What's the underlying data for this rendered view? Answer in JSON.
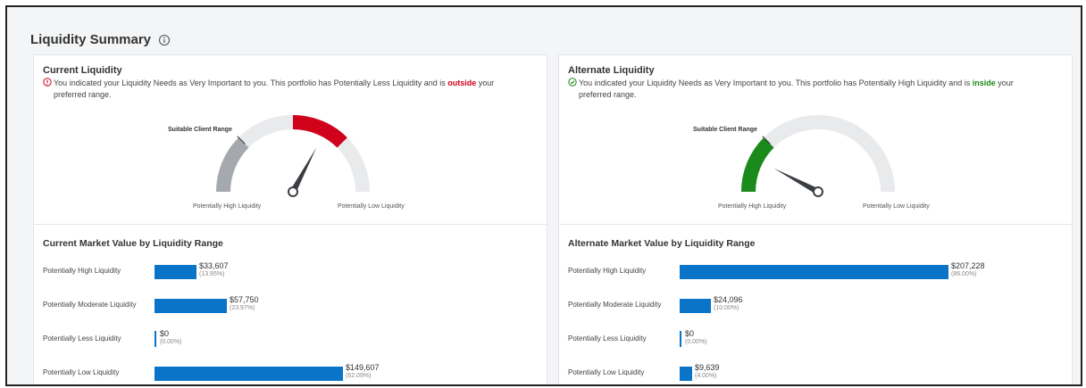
{
  "page": {
    "title": "Liquidity Summary",
    "info_icon": "info-circle-icon"
  },
  "colors": {
    "bar": "#0a74c9",
    "danger": "#d0021b",
    "success": "#1a8a1a",
    "gauge_track": "#e9eaec",
    "gauge_range": "#a5a9ae"
  },
  "current": {
    "title": "Current Liquidity",
    "status_icon": "alert-circle-icon",
    "message_pre": "You indicated your Liquidity Needs as Very Important to you. This portfolio has Potentially Less Liquidity and is ",
    "message_em": "outside",
    "message_post": " your",
    "message_line2": "preferred range.",
    "gauge": {
      "range_label": "Suitable Client Range",
      "left_label": "Potentially High Liquidity",
      "right_label": "Potentially Low Liquidity",
      "highlight_color": "#d0021b"
    },
    "bars_title": "Current Market Value by Liquidity Range",
    "bars": [
      {
        "label": "Potentially High Liquidity",
        "value": "$33,607",
        "pct": "(13.95%)",
        "fraction": 0.1395
      },
      {
        "label": "Potentially Moderate Liquidity",
        "value": "$57,750",
        "pct": "(23.97%)",
        "fraction": 0.2397
      },
      {
        "label": "Potentially Less Liquidity",
        "value": "$0",
        "pct": "(0.00%)",
        "fraction": 0
      },
      {
        "label": "Potentially Low Liquidity",
        "value": "$149,607",
        "pct": "(62.09%)",
        "fraction": 0.6209
      }
    ]
  },
  "alternate": {
    "title": "Alternate Liquidity",
    "status_icon": "check-circle-icon",
    "message_pre": "You indicated your Liquidity Needs as Very Important to you. This portfolio has Potentially High Liquidity and is ",
    "message_em": "inside",
    "message_post": " your",
    "message_line2": "preferred range.",
    "gauge": {
      "range_label": "Suitable Client Range",
      "left_label": "Potentially High Liquidity",
      "right_label": "Potentially Low Liquidity",
      "highlight_color": "#1a8a1a"
    },
    "bars_title": "Alternate Market Value by Liquidity Range",
    "bars": [
      {
        "label": "Potentially High Liquidity",
        "value": "$207,228",
        "pct": "(86.00%)",
        "fraction": 0.86
      },
      {
        "label": "Potentially Moderate Liquidity",
        "value": "$24,096",
        "pct": "(10.00%)",
        "fraction": 0.1
      },
      {
        "label": "Potentially Less Liquidity",
        "value": "$0",
        "pct": "(0.00%)",
        "fraction": 0
      },
      {
        "label": "Potentially Low Liquidity",
        "value": "$9,639",
        "pct": "(4.00%)",
        "fraction": 0.04
      }
    ]
  }
}
